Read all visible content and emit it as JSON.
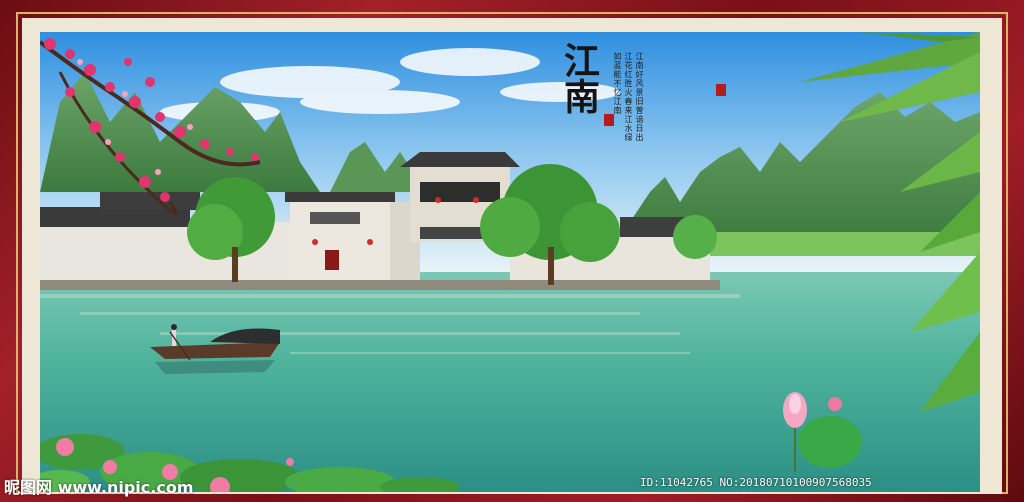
{
  "painting": {
    "calligraphy_title": "江南",
    "poem_text": "江南好风景旧曾谙日出江花红胜火春来江水绿如蓝能不忆江南"
  },
  "watermark": {
    "left_text": "昵图网 www.nipic.com",
    "right_text": "ID:11042765 NO:20180710100907568035"
  },
  "colors": {
    "frame_red": "#8a141b",
    "frame_gold": "#d9b46a",
    "mat": "#efe7d6",
    "sky": "#4aa3e6",
    "water": "#5fb8a4",
    "mountain": "#4f8a4a"
  }
}
